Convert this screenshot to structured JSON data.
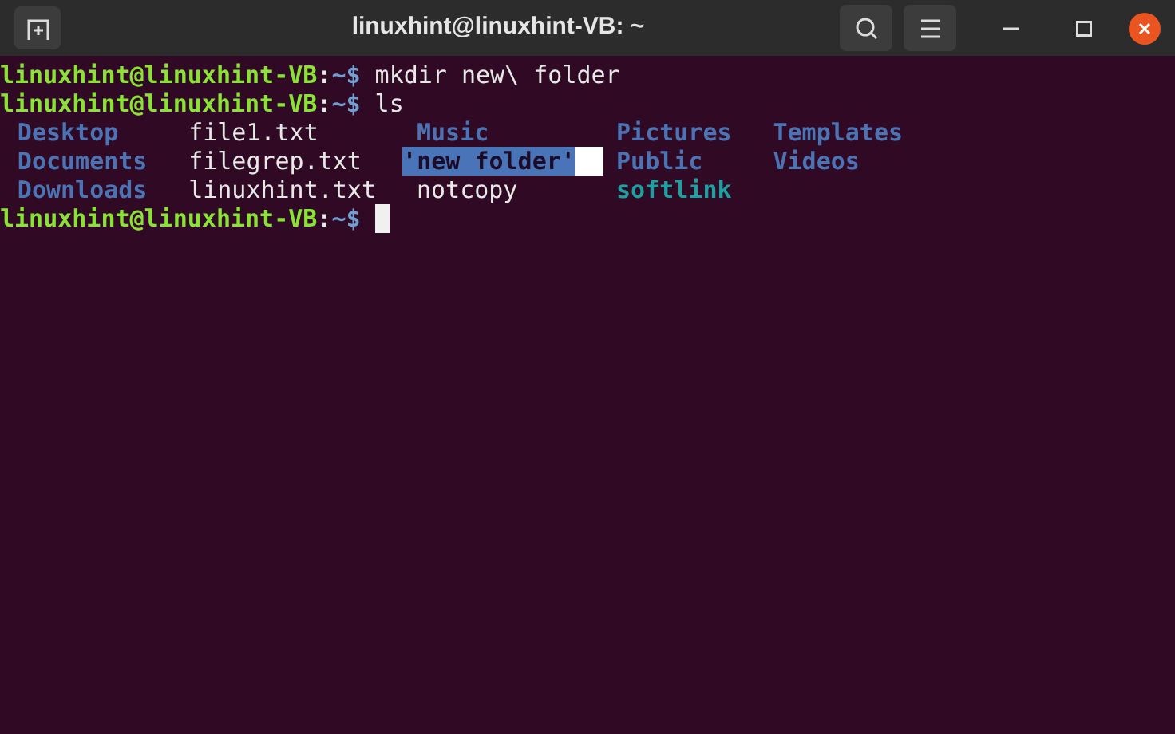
{
  "window": {
    "title": "linuxhint@linuxhint-VB: ~"
  },
  "lines": [
    {
      "kind": "prompt",
      "user_host": "linuxhint@linuxhint-VB",
      "separator": ":",
      "path": "~",
      "symbol": "$",
      "command": "mkdir new\\ folder"
    },
    {
      "kind": "prompt",
      "user_host": "linuxhint@linuxhint-VB",
      "separator": ":",
      "path": "~",
      "symbol": "$",
      "command": "ls"
    },
    {
      "kind": "listing",
      "rows": [
        [
          {
            "name": "Desktop",
            "kind": "dir",
            "selected": false
          },
          {
            "name": "file1.txt",
            "kind": "file",
            "selected": false
          },
          {
            "name": "Music",
            "kind": "dir",
            "selected": false
          },
          {
            "name": "Pictures",
            "kind": "dir",
            "selected": false
          },
          {
            "name": "Templates",
            "kind": "dir",
            "selected": false
          }
        ],
        [
          {
            "name": "Documents",
            "kind": "dir",
            "selected": false
          },
          {
            "name": "filegrep.txt",
            "kind": "file",
            "selected": false
          },
          {
            "name": "'new folder'",
            "kind": "quoted_dir",
            "selected": true
          },
          {
            "name": "Public",
            "kind": "dir",
            "selected": false
          },
          {
            "name": "Videos",
            "kind": "dir",
            "selected": false
          }
        ],
        [
          {
            "name": "Downloads",
            "kind": "dir",
            "selected": false
          },
          {
            "name": "linuxhint.txt",
            "kind": "file",
            "selected": false
          },
          {
            "name": "notcopy",
            "kind": "file",
            "selected": false
          },
          {
            "name": "softlink",
            "kind": "link",
            "selected": false
          }
        ]
      ]
    },
    {
      "kind": "prompt",
      "user_host": "linuxhint@linuxhint-VB",
      "separator": ":",
      "path": "~",
      "symbol": "$",
      "cursor": true
    }
  ]
}
